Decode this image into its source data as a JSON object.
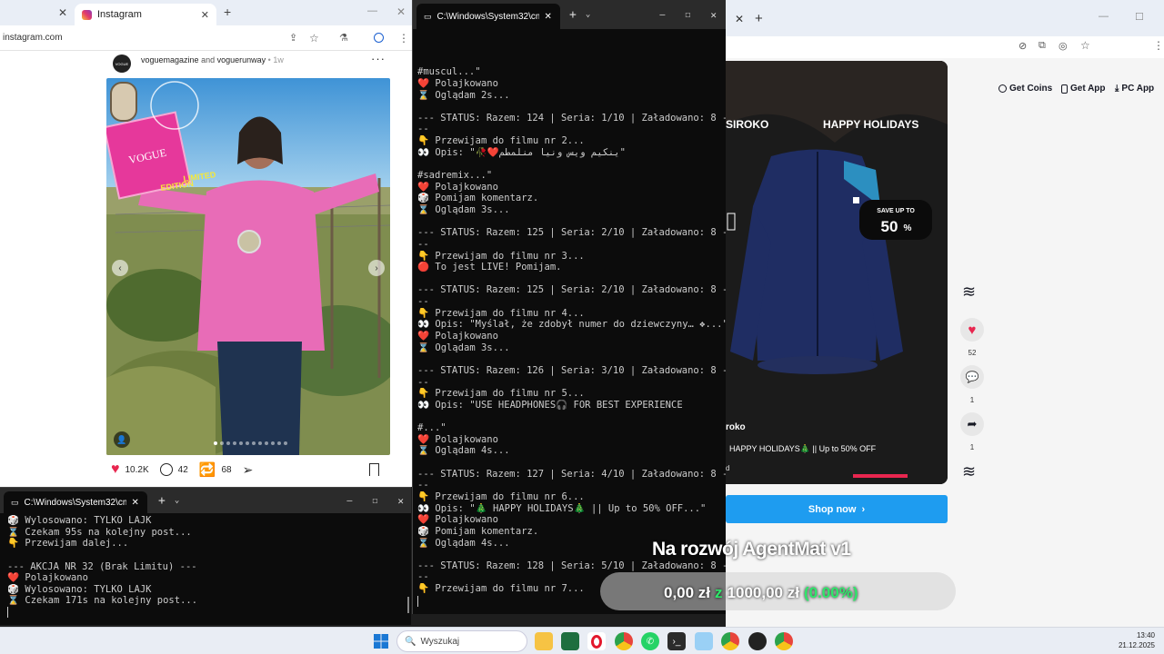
{
  "left_browser": {
    "tab_title": "Instagram",
    "address": "instagram.com",
    "post": {
      "authors_part1": "voguemagazine",
      "authors_and": "and",
      "authors_part2": "voguerunway",
      "age": "1w",
      "avatar_text": "VOGUE",
      "likes": "10.2K",
      "comments": "42",
      "reposts": "68",
      "overlay_caption": "LIMITED\nEDITION",
      "box_brand": "VOGUE"
    }
  },
  "cmd_main": {
    "tab_title": "C:\\Windows\\System32\\cmd.e",
    "lines": [
      "",
      "",
      "#muscul...\"",
      "❤️ Polajkowano",
      "⌛ Oglądam 2s...",
      "",
      "--- STATUS: Razem: 124 | Seria: 1/10 | Załadowano: 8 -",
      "--",
      "👇 Przewijam do filmu nr 2...",
      "👀 Opis: \"🥀❤️ينكيم ويس ونيا منلمطم\"",
      "",
      "#sadremix...\"",
      "❤️ Polajkowano",
      "🎲 Pomijam komentarz.",
      "⌛ Oglądam 3s...",
      "",
      "--- STATUS: Razem: 125 | Seria: 2/10 | Załadowano: 8 -",
      "--",
      "👇 Przewijam do filmu nr 3...",
      "🔴 To jest LIVE! Pomijam.",
      "",
      "--- STATUS: Razem: 125 | Seria: 2/10 | Załadowano: 8 -",
      "--",
      "👇 Przewijam do filmu nr 4...",
      "👀 Opis: \"Myślał, że zdobył numer do dziewczyny… ❖...\"",
      "❤️ Polajkowano",
      "⌛ Oglądam 3s...",
      "",
      "--- STATUS: Razem: 126 | Seria: 3/10 | Załadowano: 8 -",
      "--",
      "👇 Przewijam do filmu nr 5...",
      "👀 Opis: \"USE HEADPHONES🎧 FOR BEST EXPERIENCE",
      "",
      "#...\"",
      "❤️ Polajkowano",
      "⌛ Oglądam 4s...",
      "",
      "--- STATUS: Razem: 127 | Seria: 4/10 | Załadowano: 8 -",
      "--",
      "👇 Przewijam do filmu nr 6...",
      "👀 Opis: \"🎄 HAPPY HOLIDAYS🎄 || Up to 50% OFF...\"",
      "❤️ Polajkowano",
      "🎲 Pomijam komentarz.",
      "⌛ Oglądam 4s...",
      "",
      "--- STATUS: Razem: 128 | Seria: 5/10 | Załadowano: 8 -",
      "--",
      "👇 Przewijam do filmu nr 7...",
      ""
    ]
  },
  "cmd_small": {
    "tab_title": "C:\\Windows\\System32\\cmd.e",
    "lines": [
      "🎲 Wylosowano: TYLKO LAJK",
      "⌛ Czekam 95s na kolejny post...",
      "👇 Przewijam dalej...",
      "",
      "--- AKCJA NR 32 (Brak Limitu) ---",
      "❤️ Polajkowano",
      "🎲 Wylosowano: TYLKO LAJK",
      "⌛ Czekam 171s na kolejny post...",
      ""
    ]
  },
  "right_browser": {
    "buttons": [
      "Get Coins",
      "Get App",
      "PC App"
    ],
    "promo": {
      "brand": "SIROKO",
      "headline": "HAPPY HOLIDAYS",
      "save_label": "SAVE UP TO",
      "save_value": "50",
      "save_unit": "%",
      "account": "roko",
      "caption": "HAPPY HOLIDAYS🎄 || Up to 50% OFF",
      "small_letter": "d"
    },
    "shop_label": "Shop now",
    "actions": {
      "likes": "52",
      "comments": "1",
      "shares": "1"
    }
  },
  "overlay": {
    "title": "Na rozwój AgentMat v1",
    "amount": "0,00 zł",
    "separator": "z",
    "goal": "1000,00 zł",
    "percent": "(0.00%)"
  },
  "taskbar": {
    "search_placeholder": "Wyszukaj",
    "time": "13:40",
    "date": "21.12.2025"
  },
  "colors": {
    "cmd_bg": "#0c0c0c",
    "cmd_text": "#cccccc",
    "shop_button": "#1e9cf0",
    "overlay_green": "#2ee86a",
    "like_red": "#e8264f"
  }
}
